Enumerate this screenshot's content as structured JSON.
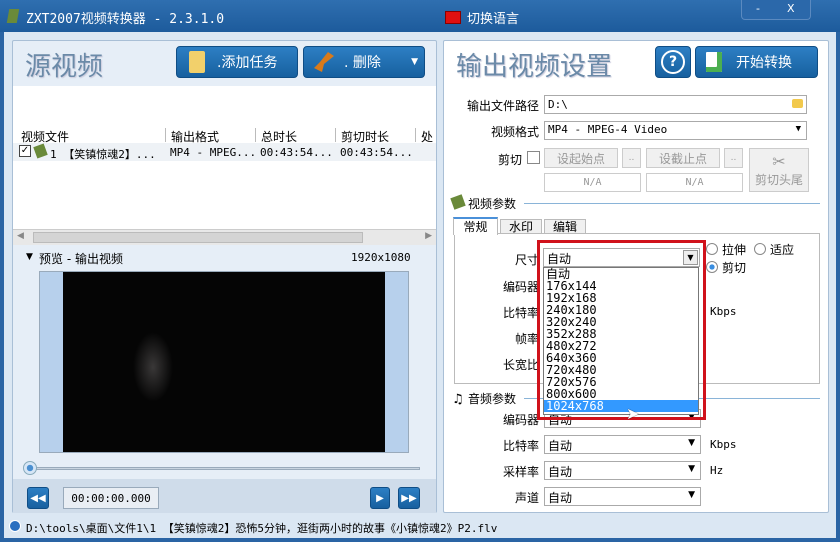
{
  "title": "ZXT2007视频转换器 - 2.3.1.0",
  "language_button": "切换语言",
  "window": {
    "minimize": "-",
    "close": "X"
  },
  "left": {
    "title": "源视频",
    "add_task": ".添加任务",
    "delete": ".  删除",
    "columns": [
      "视频文件",
      "输出格式",
      "总时长",
      "剪切时长",
      "处"
    ],
    "rows": [
      {
        "checked": true,
        "file": "1 【笑镇惊魂2】...",
        "format": "MP4 - MPEG...",
        "total": "00:43:54...",
        "cut": "00:43:54..."
      }
    ],
    "preview_label": "预览 - 输出视频",
    "resolution": "1920x1080",
    "time": "00:00:00.000",
    "progress": 0
  },
  "right": {
    "title": "输出视频设置",
    "help": "?",
    "start": "开始转换",
    "output_path_label": "输出文件路径",
    "output_path": "D:\\",
    "format_label": "视频格式",
    "format": "MP4 - MPEG-4 Video",
    "cut_label": "剪切",
    "set_start": "设起始点",
    "set_end": "设截止点",
    "dots": "..",
    "start_val": "N/A",
    "end_val": "N/A",
    "cut_ends": "剪切头尾",
    "video_params": "视频参数",
    "tabs": [
      "常规",
      "水印",
      "编辑"
    ],
    "size_label": "尺寸",
    "size_value": "自动",
    "encoder_label": "编码器",
    "bitrate_label": "比特率",
    "fps_label": "帧率",
    "aspect_label": "长宽比",
    "kbps": "Kbps",
    "radio_stretch": "拉伸",
    "radio_fit": "适应",
    "radio_crop": "剪切",
    "size_options": [
      "自动",
      "176x144",
      "192x168",
      "240x180",
      "320x240",
      "352x288",
      "480x272",
      "640x360",
      "720x480",
      "720x576",
      "800x600",
      "1024x768"
    ],
    "highlighted_option": "1024x768",
    "audio_params": "音频参数",
    "audio_encoder": "自动",
    "audio_bitrate": "自动",
    "samplerate_label": "采样率",
    "samplerate": "自动",
    "hz": "Hz",
    "channel_label": "声道",
    "channel": "自动"
  },
  "status": "D:\\tools\\桌面\\文件1\\1 【笑镇惊魂2】恐怖5分钟，逛街两小时的故事《小镇惊魂2》P2.flv",
  "colors": {
    "highlight": "#3399ff",
    "callout": "#d0121b",
    "title_bar": "#1d5b9c"
  }
}
